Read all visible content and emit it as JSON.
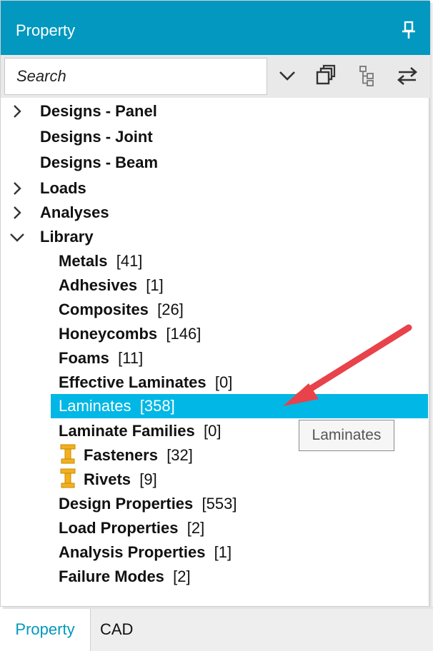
{
  "panel": {
    "title": "Property",
    "pin_icon": "pin-icon"
  },
  "toolbar": {
    "search_placeholder": "Search",
    "buttons": [
      "chevron-down-icon",
      "copy-icon",
      "tree-icon",
      "swap-icon"
    ]
  },
  "tree": {
    "top": [
      {
        "label": "Designs - Panel",
        "expander": "collapsed"
      },
      {
        "label": "Designs - Joint",
        "expander": "none"
      },
      {
        "label": "Designs - Beam",
        "expander": "none"
      },
      {
        "label": "Loads",
        "expander": "collapsed"
      },
      {
        "label": "Analyses",
        "expander": "collapsed"
      },
      {
        "label": "Library",
        "expander": "expanded"
      }
    ],
    "library": [
      {
        "name": "Metals",
        "count": "[41]"
      },
      {
        "name": "Adhesives",
        "count": "[1]"
      },
      {
        "name": "Composites",
        "count": "[26]"
      },
      {
        "name": "Honeycombs",
        "count": "[146]"
      },
      {
        "name": "Foams",
        "count": "[11]"
      },
      {
        "name": "Effective Laminates",
        "count": "[0]"
      },
      {
        "name": "Laminates",
        "count": "[358]",
        "selected": true
      },
      {
        "name": "Laminate Families",
        "count": "[0]"
      },
      {
        "name": "Fasteners",
        "count": "[32]",
        "icon": "fastener-icon"
      },
      {
        "name": "Rivets",
        "count": "[9]",
        "icon": "rivet-icon"
      },
      {
        "name": "Design Properties",
        "count": "[553]"
      },
      {
        "name": "Load Properties",
        "count": "[2]"
      },
      {
        "name": "Analysis Properties",
        "count": "[1]"
      },
      {
        "name": "Failure Modes",
        "count": "[2]"
      }
    ]
  },
  "tooltip": "Laminates",
  "annotation": {
    "type": "arrow",
    "color": "#e8424a"
  },
  "tabs": [
    {
      "label": "Property",
      "active": true
    },
    {
      "label": "CAD",
      "active": false
    }
  ],
  "colors": {
    "header": "#0298bf",
    "selection": "#00b7e5",
    "fastener_icon": "#f2b01e"
  }
}
